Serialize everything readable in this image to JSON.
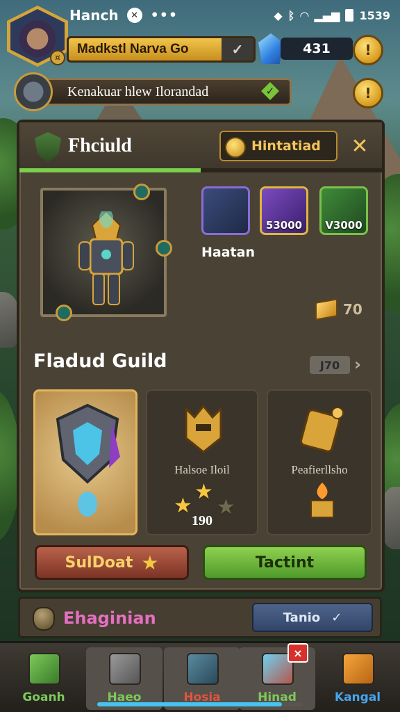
{
  "status_bar": {
    "app_title": "Hanch",
    "time": "1539"
  },
  "profile": {
    "name_line": "Madkstl Narva Go",
    "gem_count": "431"
  },
  "quest": {
    "text": "Kenakuar hlew Ilorandad"
  },
  "panel": {
    "title": "Fhciuld",
    "header_button": "Hintatiad",
    "progress_fraction": 0.5,
    "hero_name": "Haatan",
    "slots": [
      {
        "value": "",
        "color": "#8a6cd6"
      },
      {
        "value": "53000",
        "color": "#e0b640"
      },
      {
        "value": "V3000",
        "color": "#7bc04a"
      }
    ],
    "stack_value": "70",
    "guild_title": "Fladud Guild",
    "guild_count": "J70",
    "cards": [
      {
        "label": "",
        "value": ""
      },
      {
        "label": "Halsoe Iloil",
        "value": "190"
      },
      {
        "label": "Peafierllsho",
        "value": ""
      }
    ],
    "rating": {
      "filled": 2,
      "total": 3
    },
    "left_button": "SulDoat",
    "right_button": "Tactint"
  },
  "lower_bar": {
    "label": "Ehaginian",
    "button": "Tanio"
  },
  "nav": {
    "items": [
      {
        "label": "Goanh",
        "color": "#7cc95a"
      },
      {
        "label": "Haeo",
        "color": "#7cc95a"
      },
      {
        "label": "Hosia",
        "color": "#e2543d"
      },
      {
        "label": "Hinad",
        "color": "#7cc95a"
      },
      {
        "label": "Kangal",
        "color": "#46a6ef"
      }
    ],
    "badge": "×",
    "scroll_fraction": 0.9
  }
}
